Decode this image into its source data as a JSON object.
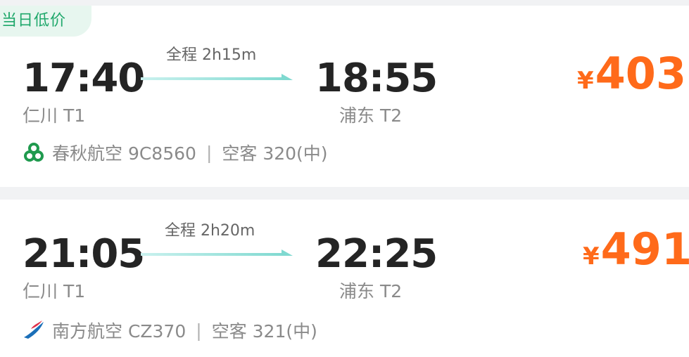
{
  "flights": [
    {
      "tag": "当日低价",
      "duration": "全程 2h15m",
      "depart_time": "17:40",
      "depart_airport": "仁川 T1",
      "arrive_time": "18:55",
      "arrive_airport": "浦东 T2",
      "currency": "¥",
      "price": "403",
      "airline": "春秋航空 9C8560",
      "separator": "|",
      "aircraft": "空客 320(中)",
      "logo_icon": "spring-airlines-logo-icon"
    },
    {
      "duration": "全程 2h20m",
      "depart_time": "21:05",
      "depart_airport": "仁川 T1",
      "arrive_time": "22:25",
      "arrive_airport": "浦东 T2",
      "currency": "¥",
      "price": "491",
      "airline": "南方航空 CZ370",
      "separator": "|",
      "aircraft": "空客 321(中)",
      "logo_icon": "china-southern-logo-icon"
    }
  ],
  "colors": {
    "price": "#ff6a1a",
    "tag_text": "#1fa86b",
    "tag_bg": "#e7f6ef",
    "arrow": "#8fe0d8"
  }
}
